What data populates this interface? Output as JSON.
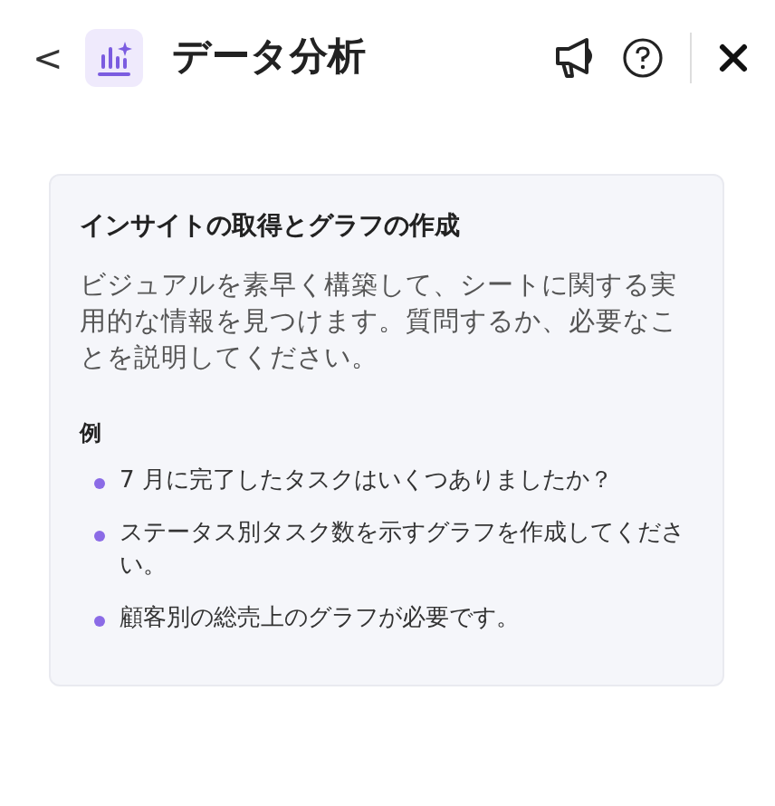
{
  "header": {
    "back": "<",
    "title": "データ分析"
  },
  "card": {
    "heading": "インサイトの取得とグラフの作成",
    "description": "ビジュアルを素早く構築して、シートに関する実用的な情報を見つけます。質問するか、必要なことを説明してください。",
    "examples_label": "例",
    "examples": [
      "7 月に完了したタスクはいくつありましたか？",
      "ステータス別タスク数を示すグラフを作成してください。",
      "顧客別の総売上のグラフが必要です。"
    ]
  }
}
